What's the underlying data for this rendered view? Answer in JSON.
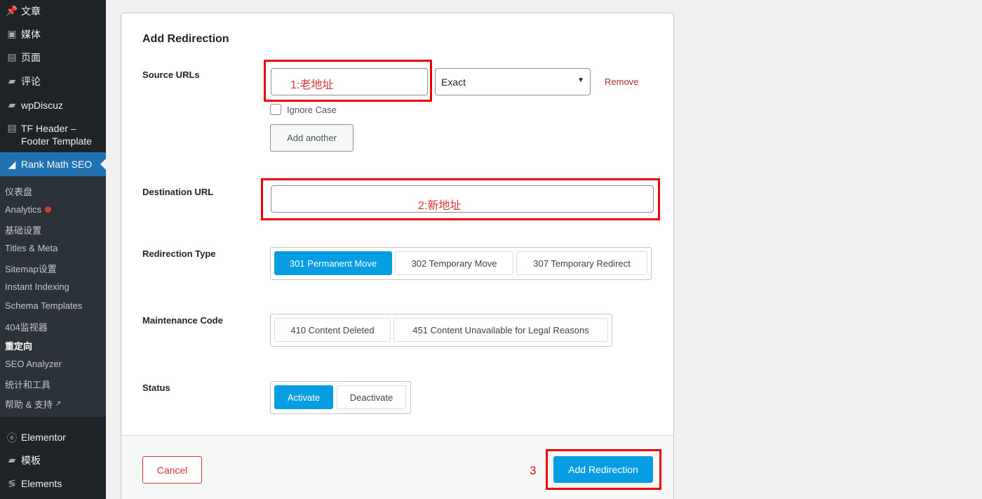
{
  "sidebar": {
    "items": [
      {
        "label": "文章",
        "icon": "pin-icon",
        "glyph": "📌"
      },
      {
        "label": "媒体",
        "icon": "media-icon",
        "glyph": "▣"
      },
      {
        "label": "页面",
        "icon": "page-icon",
        "glyph": "▤"
      },
      {
        "label": "评论",
        "icon": "comment-icon",
        "glyph": "▰"
      },
      {
        "label": "wpDiscuz",
        "icon": "comment-icon",
        "glyph": "▰"
      },
      {
        "label": "TF Header –\nFooter Template",
        "icon": "page-icon",
        "glyph": "▤"
      }
    ],
    "active": {
      "label": "Rank Math SEO",
      "icon": "rank-math-icon",
      "glyph": "◢"
    },
    "submenu": [
      {
        "label": "仪表盘"
      },
      {
        "label": "Analytics"
      },
      {
        "label": "基础设置"
      },
      {
        "label": "Titles & Meta"
      },
      {
        "label": "Sitemap设置"
      },
      {
        "label": "Instant Indexing"
      },
      {
        "label": "Schema Templates"
      },
      {
        "label": "404监视器"
      },
      {
        "label": "重定向"
      },
      {
        "label": "SEO Analyzer"
      },
      {
        "label": "统计和工具"
      },
      {
        "label": "帮助 & 支持"
      }
    ],
    "bottom": [
      {
        "label": "Elementor",
        "icon": "elementor-icon",
        "glyph": "ⓔ"
      },
      {
        "label": "模板",
        "icon": "folder-icon",
        "glyph": "▰"
      },
      {
        "label": "Elements",
        "icon": "elements-icon",
        "glyph": "≶"
      }
    ]
  },
  "form": {
    "title": "Add Redirection",
    "source_label": "Source URLs",
    "source_value": "1:老地址",
    "match_select": "Exact",
    "remove_label": "Remove",
    "ignore_case_label": "Ignore Case",
    "add_another_label": "Add another",
    "destination_label": "Destination URL",
    "destination_value": "2:新地址",
    "redirection_type_label": "Redirection Type",
    "redirection_types": [
      "301 Permanent Move",
      "302 Temporary Move",
      "307 Temporary Redirect"
    ],
    "maintenance_label": "Maintenance Code",
    "maintenance_codes": [
      "410 Content Deleted",
      "451 Content Unavailable for Legal Reasons"
    ],
    "status_label": "Status",
    "status_options": [
      "Activate",
      "Deactivate"
    ],
    "cancel_label": "Cancel",
    "submit_label": "Add Redirection"
  },
  "annotations": {
    "step3": "3"
  },
  "colors": {
    "accent": "#069de3",
    "annotation": "#e00000",
    "sidebar_bg": "#1d2327",
    "active_menu": "#2271b1"
  }
}
